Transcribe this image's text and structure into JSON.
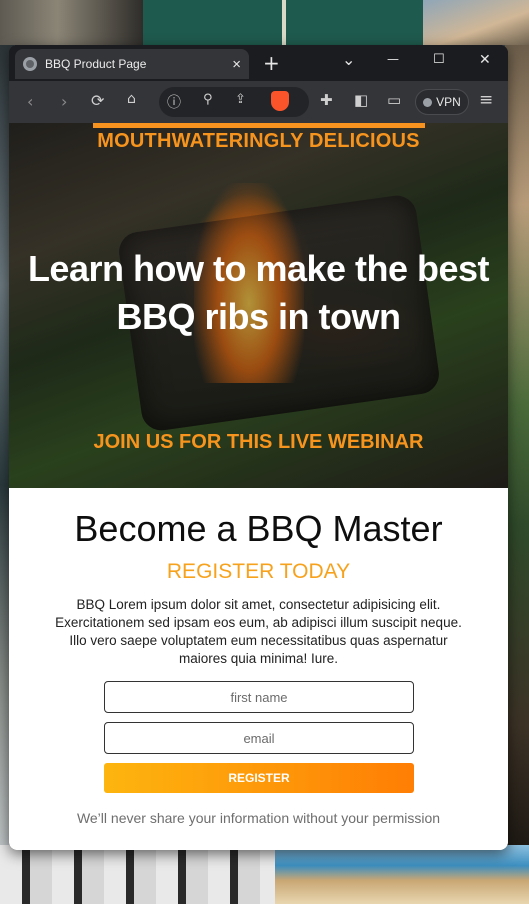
{
  "browser": {
    "tab_title": "BBQ Product Page",
    "tab_close": "×",
    "new_tab": "+",
    "dropdown": "⌄",
    "minimize": "—",
    "maximize": "☐",
    "close": "✕",
    "vpn_label": "VPN",
    "icons": [
      "back-icon",
      "forward-icon",
      "reload-icon",
      "bookmark-icon",
      "info-icon",
      "zoom-icon",
      "share-icon",
      "brave-shield-icon",
      "extensions-icon",
      "sidebar-icon",
      "wallet-icon",
      "menu-icon"
    ]
  },
  "hero": {
    "eyebrow": "MOUTHWATERINGLY DELICIOUS",
    "headline_prefix": "Learn how to make ",
    "headline_bold": "the best BBQ ribs",
    "headline_suffix": " in town",
    "subline": "JOIN US FOR THIS LIVE WEBINAR",
    "accent_color": "#f7941d"
  },
  "signup": {
    "title": "Become a BBQ Master",
    "subtitle": "REGISTER TODAY",
    "description": "BBQ Lorem ipsum dolor sit amet, consectetur adipisicing elit. Exercitationem sed ipsam eos eum, ab adipisci illum suscipit neque. Illo vero saepe voluptatem eum necessitatibus quas aspernatur maiores quia minima! Iure.",
    "first_name_placeholder": "first name",
    "email_placeholder": "email",
    "button_label": "REGISTER",
    "privacy_note": "We’ll never share your information without your permission",
    "button_gradient": [
      "#fdb50f",
      "#ff7e04"
    ]
  }
}
